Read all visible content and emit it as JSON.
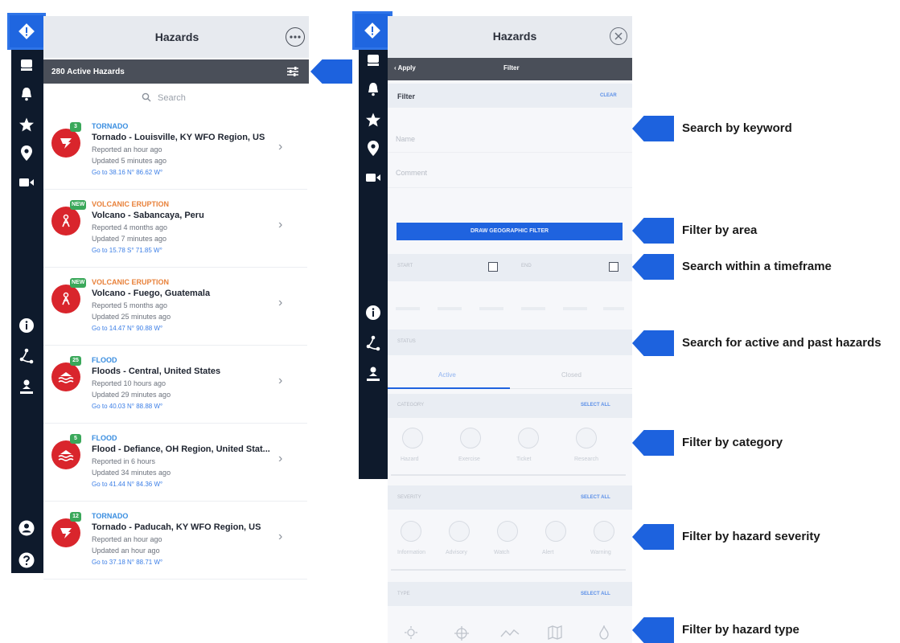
{
  "colors": {
    "rail": "#0e1a2c",
    "accent": "#1f63df",
    "hazard_red": "#d9252c",
    "badge_green": "#3aa85a",
    "tornado_cat": "#3a8ee0",
    "volcano_cat": "#e8813a",
    "flood_cat": "#3a8ee0"
  },
  "left": {
    "title": "Hazards",
    "active_count": "280 Active Hazards",
    "search_placeholder": "Search",
    "rail_icons": [
      "hazard-diamond-icon",
      "desktop-icon",
      "bell-icon",
      "star-icon",
      "location-pin-icon",
      "video-camera-icon",
      "info-icon",
      "route-icon",
      "map-pin-person-icon",
      "user-icon",
      "help-icon"
    ],
    "hazards": [
      {
        "badge": "3",
        "category": "TORNADO",
        "name": "Tornado - Louisville, KY WFO Region, US",
        "reported": "Reported an hour ago",
        "updated": "Updated 5 minutes ago",
        "coords": "Go to 38.16 N° 86.62 W°",
        "icon": "tornado-icon",
        "cat_color": "#3a8ee0"
      },
      {
        "badge": "NEW",
        "category": "VOLCANIC ERUPTION",
        "name": "Volcano - Sabancaya, Peru",
        "reported": "Reported 4 months ago",
        "updated": "Updated 7 minutes ago",
        "coords": "Go to 15.78 S° 71.85 W°",
        "icon": "volcano-icon",
        "cat_color": "#e8813a"
      },
      {
        "badge": "NEW",
        "category": "VOLCANIC ERUPTION",
        "name": "Volcano - Fuego, Guatemala",
        "reported": "Reported 5 months ago",
        "updated": "Updated 25 minutes ago",
        "coords": "Go to 14.47 N° 90.88 W°",
        "icon": "volcano-icon",
        "cat_color": "#e8813a"
      },
      {
        "badge": "25",
        "category": "FLOOD",
        "name": "Floods - Central, United States",
        "reported": "Reported 10 hours ago",
        "updated": "Updated 29 minutes ago",
        "coords": "Go to 40.03 N° 88.88 W°",
        "icon": "flood-icon",
        "cat_color": "#3a8ee0"
      },
      {
        "badge": "5",
        "category": "FLOOD",
        "name": "Flood - Defiance, OH Region, United Stat...",
        "reported": "Reported in 6 hours",
        "updated": "Updated 34 minutes ago",
        "coords": "Go to 41.44 N° 84.36 W°",
        "icon": "flood-icon",
        "cat_color": "#3a8ee0"
      },
      {
        "badge": "12",
        "category": "TORNADO",
        "name": "Tornado - Paducah, KY WFO Region, US",
        "reported": "Reported an hour ago",
        "updated": "Updated an hour ago",
        "coords": "Go to 37.18 N° 88.71 W°",
        "icon": "tornado-icon",
        "cat_color": "#3a8ee0"
      }
    ]
  },
  "right": {
    "title": "Hazards",
    "apply_label": "Apply",
    "filter_header": "Filter",
    "filter_label": "Filter",
    "clear_label": "CLEAR",
    "name_placeholder": "Name",
    "comment_placeholder": "Comment",
    "geo_button": "DRAW GEOGRAPHIC FILTER",
    "start_label": "START",
    "end_label": "END",
    "status_label": "STATUS",
    "tab_active": "Active",
    "tab_closed": "Closed",
    "category_label": "CATEGORY",
    "category_select_all": "SELECT ALL",
    "category_items": [
      "Hazard",
      "Exercise",
      "Ticket",
      "Research"
    ],
    "severity_label": "SEVERITY",
    "severity_select_all": "SELECT ALL",
    "severity_items": [
      "Information",
      "Advisory",
      "Watch",
      "Alert",
      "Warning"
    ],
    "type_label": "TYPE",
    "type_select_all": "SELECT ALL",
    "rail_icons": [
      "hazard-diamond-icon",
      "desktop-icon",
      "bell-icon",
      "star-icon",
      "location-pin-icon",
      "video-camera-icon",
      "info-icon",
      "route-icon",
      "map-pin-person-icon"
    ]
  },
  "annotations": [
    "Search by keyword",
    "Filter by area",
    "Search within a timeframe",
    "Search for active and past hazards",
    "Filter by category",
    "Filter by hazard severity",
    "Filter by hazard type"
  ]
}
